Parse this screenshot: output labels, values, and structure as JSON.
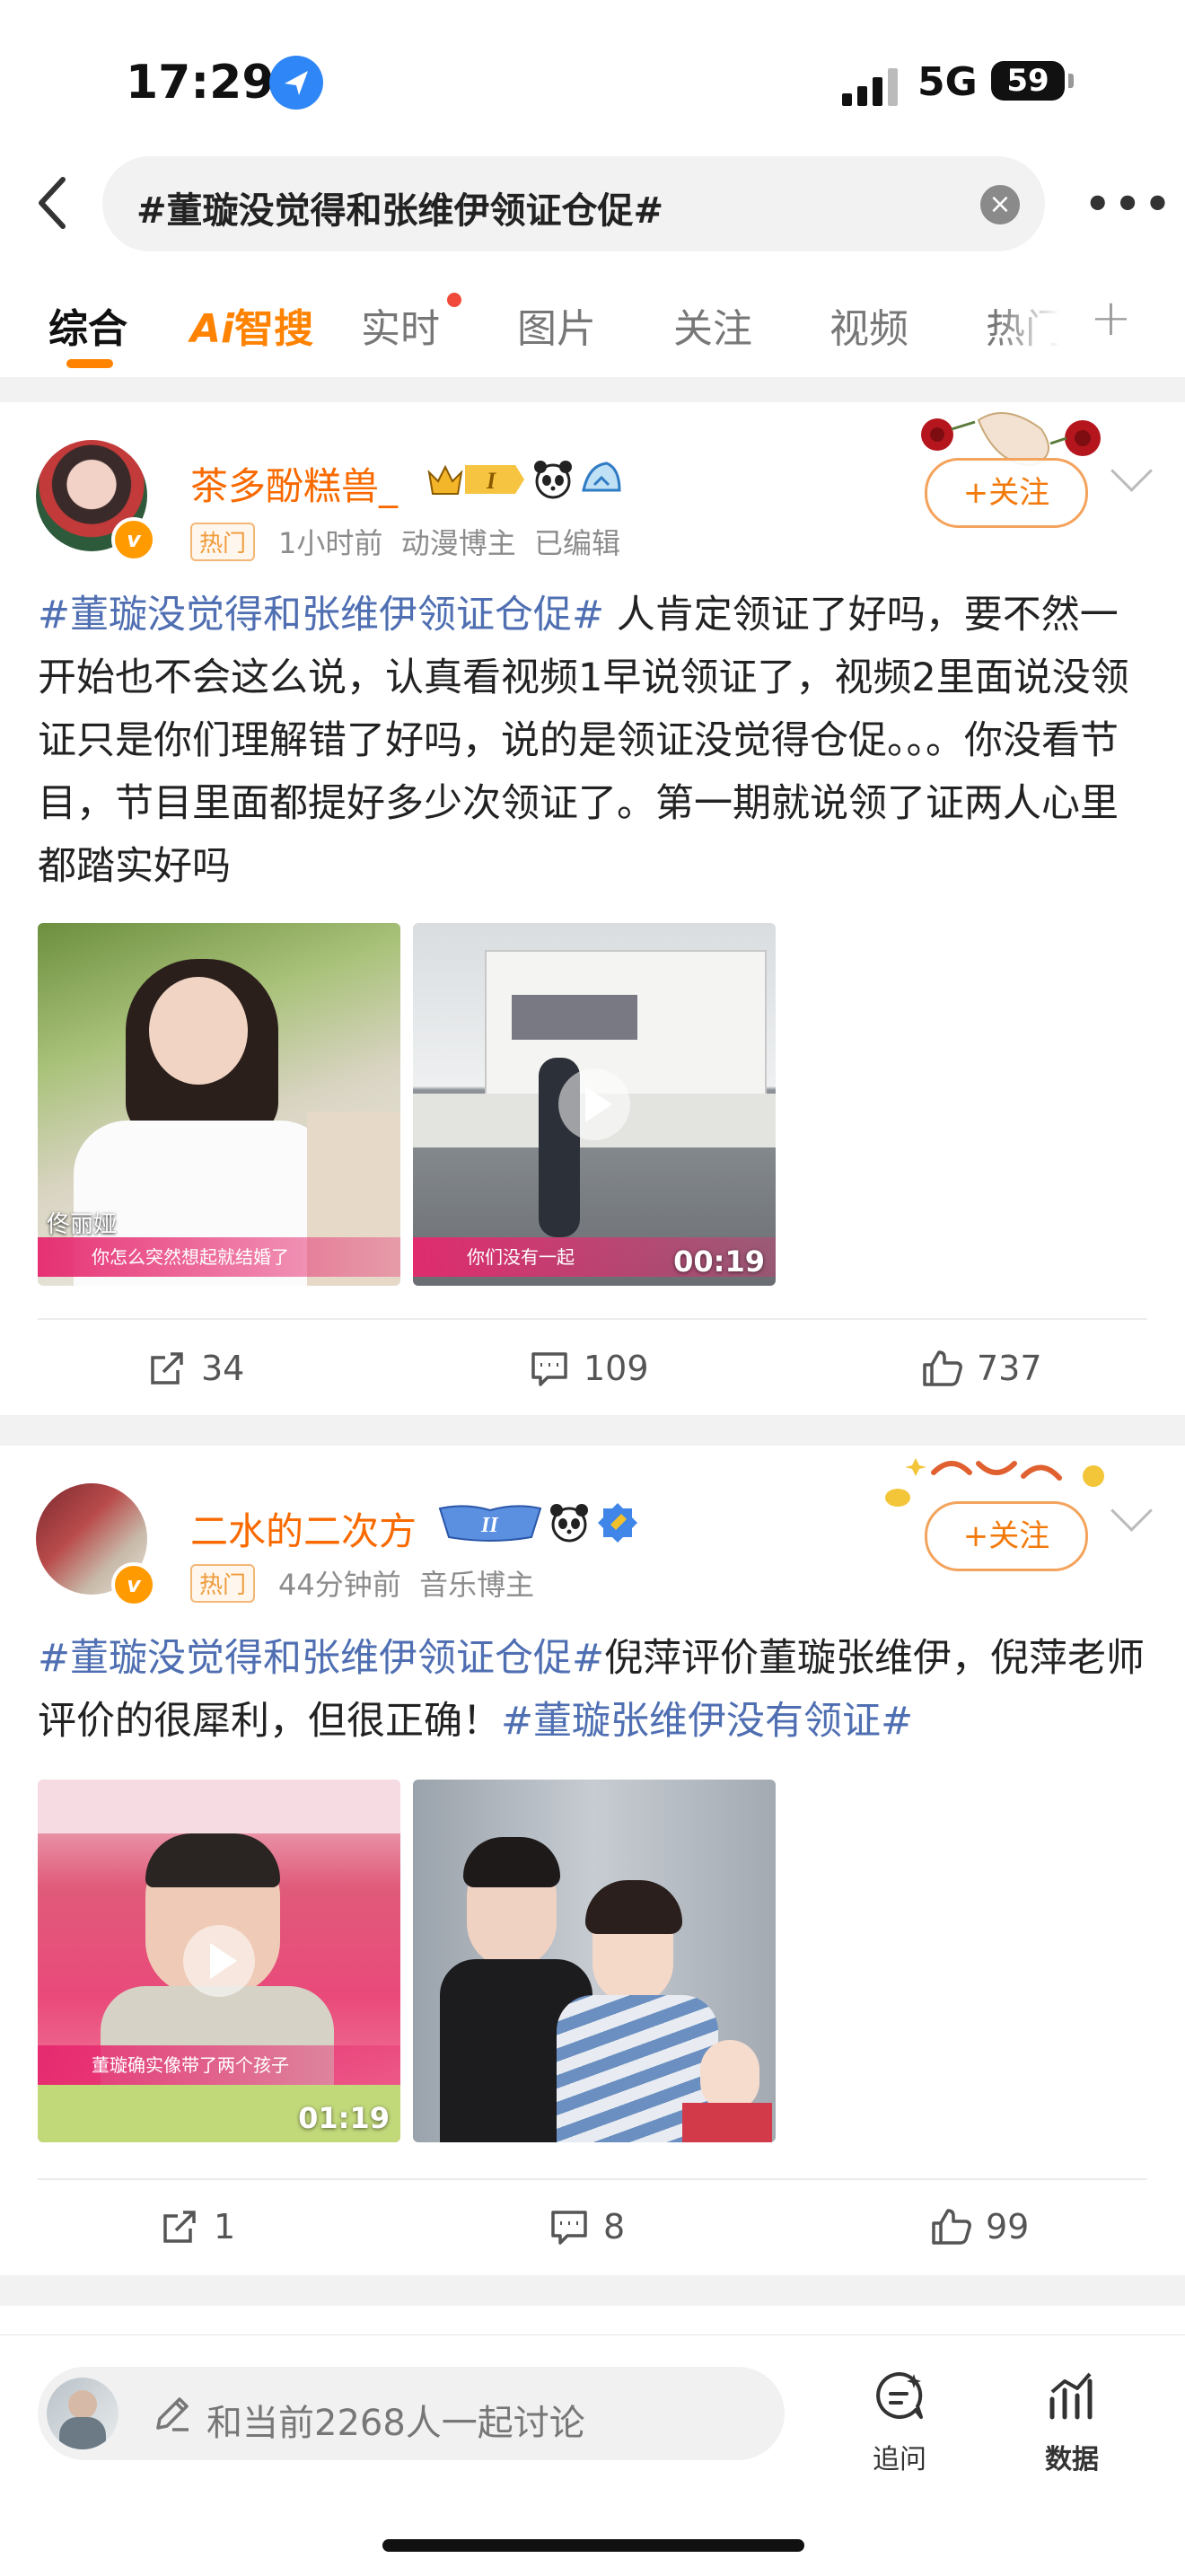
{
  "status_bar": {
    "time": "17:29",
    "network": "5G",
    "battery": "59"
  },
  "search": {
    "query": "#董璇没觉得和张维伊领证仓促#"
  },
  "tabs": [
    {
      "label": "综合"
    },
    {
      "label": "智搜",
      "prefix": "Ai"
    },
    {
      "label": "实时"
    },
    {
      "label": "图片"
    },
    {
      "label": "关注"
    },
    {
      "label": "视频"
    },
    {
      "label": "热门"
    }
  ],
  "posts": [
    {
      "username": "茶多酚糕兽_",
      "tag": "热门",
      "meta": "1小时前  动漫博主  已编辑",
      "follow_label": "+关注",
      "text": {
        "hashtag": "#董璇没觉得和张维伊领证仓促#",
        "body": " 人肯定领证了好吗，要不然一开始也不会这么说，认真看视频1早说领证了，视频2里面说没领证只是你们理解错了好吗，说的是领证没觉得仓促。。。你没看节目，节目里面都提好多少次领证了。第一期就说领了证两人心里都踏实好吗"
      },
      "media": [
        {
          "caption": "你怎么突然想起就结婚了",
          "name_tag": "佟丽娅"
        },
        {
          "caption": "你们没有一起",
          "duration": "00:19"
        }
      ],
      "actions": {
        "reposts": "34",
        "comments": "109",
        "likes": "737"
      }
    },
    {
      "username": "二水的二次方",
      "tag": "热门",
      "meta": "44分钟前  音乐博主",
      "follow_label": "+关注",
      "text": {
        "hashtag": "#董璇没觉得和张维伊领证仓促#",
        "body": "倪萍评价董璇张维伊，倪萍老师评价的很犀利，但很正确！",
        "hashtag2": "#董璇张维伊没有领证#"
      },
      "media": [
        {
          "caption": "董璇确实像带了两个孩子",
          "duration": "01:19"
        },
        {
          "caption": ""
        }
      ],
      "actions": {
        "reposts": "1",
        "comments": "8",
        "likes": "99"
      }
    }
  ],
  "bottom_bar": {
    "discuss_placeholder": "和当前2268人一起讨论",
    "ask_label": "追问",
    "data_label": "数据"
  },
  "colors": {
    "accent": "#ff8200",
    "username": "#f86a00",
    "hashtag": "#4f6fb2"
  }
}
